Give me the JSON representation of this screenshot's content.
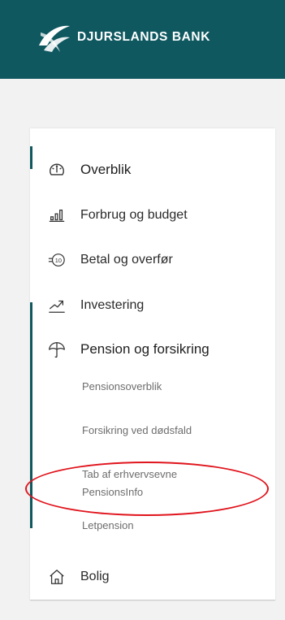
{
  "brand": {
    "name": "DJURSLANDS BANK"
  },
  "menu": {
    "overblik": "Overblik",
    "forbrug": "Forbrug og budget",
    "betal": "Betal og overfør",
    "investering": "Investering",
    "pension": "Pension og forsikring",
    "bolig": "Bolig"
  },
  "submenu": {
    "pensionsoverblik": "Pensionsoverblik",
    "forsikring": "Forsikring ved dødsfald",
    "tab": "Tab af erhvervsevne",
    "pensionsinfo": "PensionsInfo",
    "letpension": "Letpension"
  },
  "colors": {
    "header": "#0f5860",
    "accent_bar": "#0f5860",
    "highlight": "#e0141c"
  },
  "icons": {
    "overblik": "speedometer-icon",
    "forbrug": "bar-chart-icon",
    "betal": "coin-transfer-icon",
    "investering": "trend-line-icon",
    "pension": "umbrella-icon",
    "bolig": "house-icon"
  }
}
